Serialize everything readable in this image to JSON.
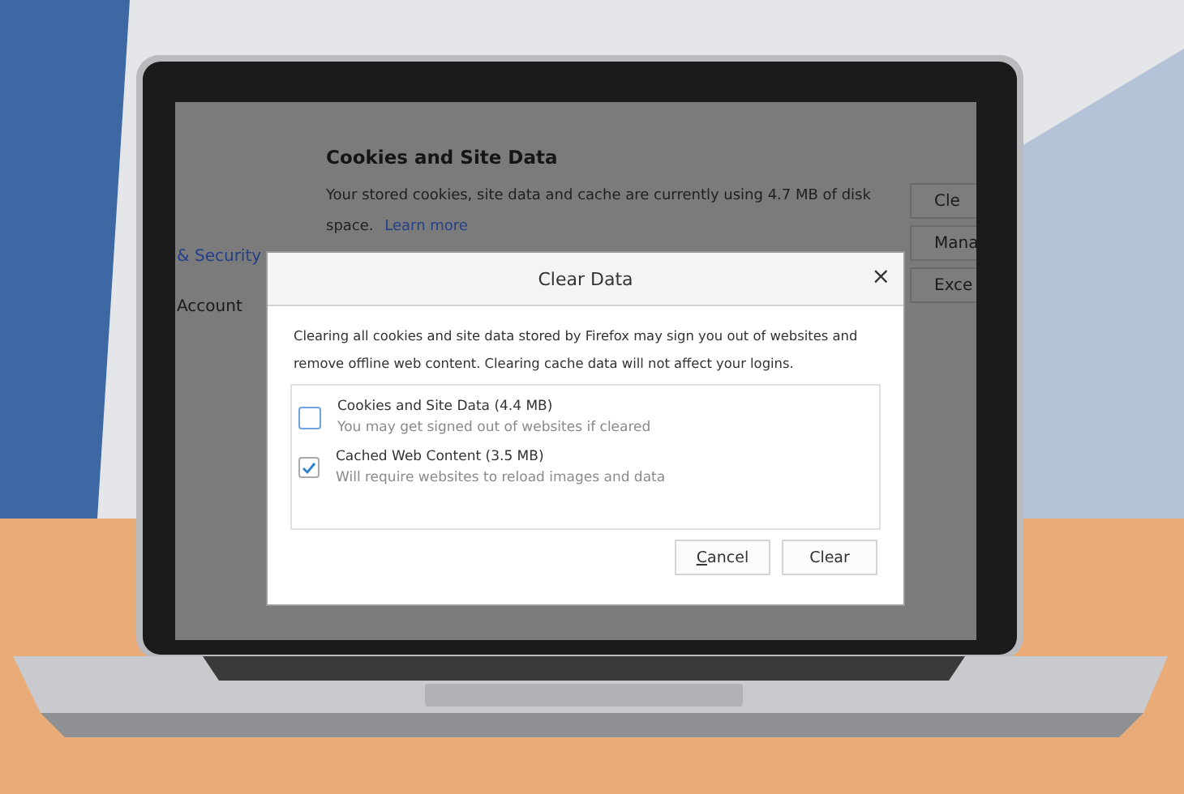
{
  "settings_page": {
    "sidebar": [
      {
        "label": "& Security",
        "selected": true
      },
      {
        "label": "Account",
        "selected": false
      }
    ],
    "section": {
      "title": "Cookies and Site Data",
      "text": "Your stored cookies, site data and cache are currently using 4.7 MB of disk space.",
      "link": "Learn more"
    },
    "side_buttons": [
      "Cle",
      "Mana",
      "Exce"
    ]
  },
  "dialog": {
    "title": "Clear Data",
    "close": "×",
    "message": "Clearing all cookies and site data stored by Firefox may sign you out of websites and remove offline web content. Clearing cache data will not affect your logins.",
    "options": [
      {
        "label": "Cookies and Site Data (4.4 MB)",
        "hint": "You may get signed out of websites if cleared",
        "checked": false
      },
      {
        "label": "Cached Web Content (3.5 MB)",
        "hint": "Will require websites to reload images and data",
        "checked": true
      }
    ],
    "buttons": [
      "Cancel",
      "Clear"
    ]
  }
}
